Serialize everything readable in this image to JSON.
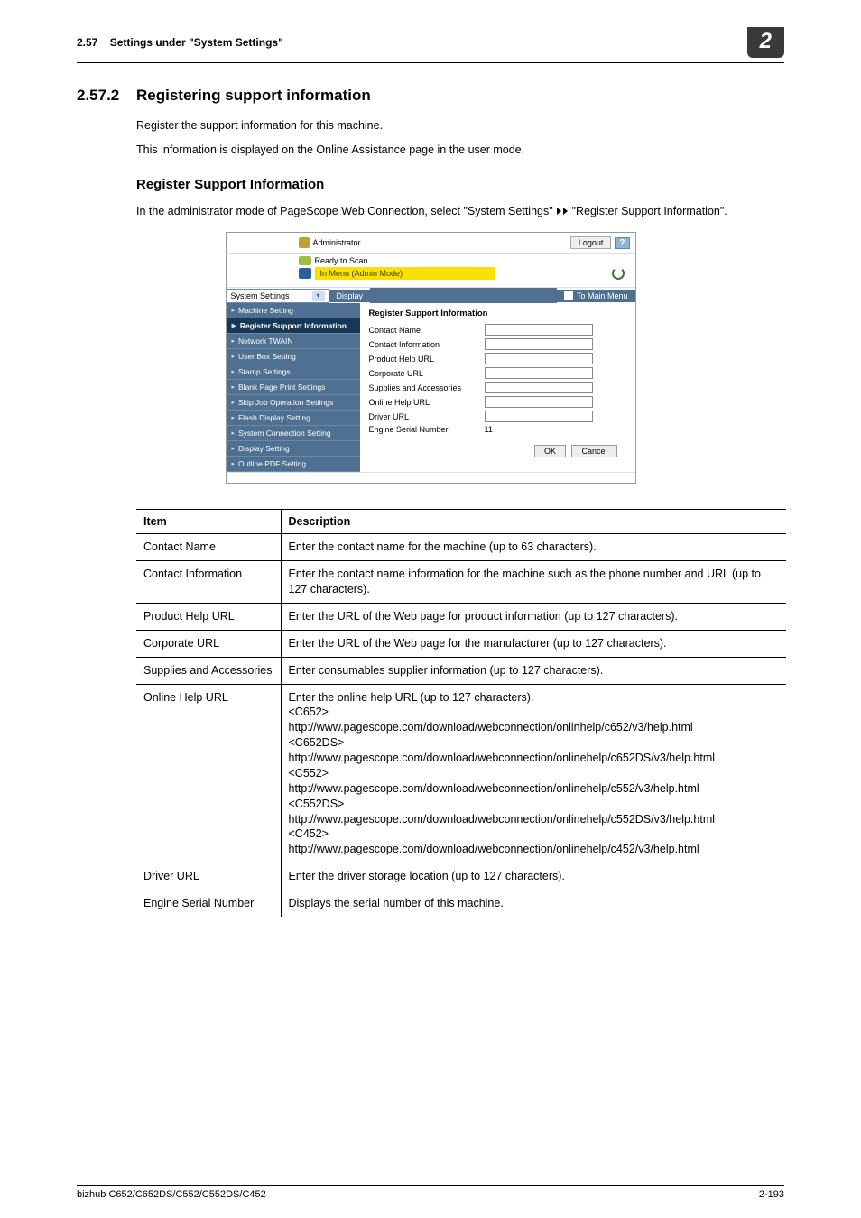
{
  "header": {
    "section_ref": "2.57",
    "section_label": "Settings under \"System Settings\"",
    "chapter_badge": "2"
  },
  "section": {
    "number": "2.57.2",
    "title": "Registering support information",
    "intro1": "Register the support information for this machine.",
    "intro2": "This information is displayed on the Online Assistance page in the user mode."
  },
  "subsection": {
    "title": "Register Support Information",
    "body_prefix": "In the administrator mode of PageScope Web Connection, select \"System Settings\" ",
    "body_suffix": " \"Register Support Information\"."
  },
  "screenshot": {
    "admin_label": "Administrator",
    "logout": "Logout",
    "help": "?",
    "ready": "Ready to Scan",
    "banner": "In Menu (Admin Mode)",
    "select_value": "System Settings",
    "display_btn": "Display",
    "to_main": "To Main Menu",
    "nav": [
      "Machine Setting",
      "Register Support Information",
      "Network TWAIN",
      "User Box Setting",
      "Stamp Settings",
      "Blank Page Print Settings",
      "Skip Job Operation Settings",
      "Flash Display Setting",
      "System Connection Setting",
      "Display Setting",
      "Outline PDF Setting"
    ],
    "form_title": "Register Support Information",
    "fields": [
      "Contact Name",
      "Contact Information",
      "Product Help URL",
      "Corporate URL",
      "Supplies and Accessories",
      "Online Help URL",
      "Driver URL"
    ],
    "serial_label": "Engine Serial Number",
    "serial_value": "11",
    "ok": "OK",
    "cancel": "Cancel"
  },
  "table": {
    "head_item": "Item",
    "head_desc": "Description",
    "rows": [
      {
        "item": "Contact Name",
        "desc": "Enter the contact name for the machine (up to 63 characters)."
      },
      {
        "item": "Contact Information",
        "desc": "Enter the contact name information for the machine such as the phone number and URL (up to 127 characters)."
      },
      {
        "item": "Product Help URL",
        "desc": "Enter the URL of the Web page for product information (up to 127 characters)."
      },
      {
        "item": "Corporate URL",
        "desc": "Enter the URL of the Web page for the manufacturer (up to 127 characters)."
      },
      {
        "item": "Supplies and Accessories",
        "desc": "Enter consumables supplier information (up to 127 characters)."
      },
      {
        "item": "Online Help URL",
        "desc": "Enter the online help URL (up to 127 characters).\n<C652>\nhttp://www.pagescope.com/download/webconnection/onlinhelp/c652/v3/help.html\n<C652DS>\nhttp://www.pagescope.com/download/webconnection/onlinehelp/c652DS/v3/help.html\n<C552>\nhttp://www.pagescope.com/download/webconnection/onlinehelp/c552/v3/help.html\n<C552DS>\nhttp://www.pagescope.com/download/webconnection/onlinehelp/c552DS/v3/help.html\n<C452>\nhttp://www.pagescope.com/download/webconnection/onlinehelp/c452/v3/help.html"
      },
      {
        "item": "Driver URL",
        "desc": "Enter the driver storage location (up to 127 characters)."
      },
      {
        "item": "Engine Serial Number",
        "desc": "Displays the serial number of this machine."
      }
    ]
  },
  "footer": {
    "left": "bizhub C652/C652DS/C552/C552DS/C452",
    "right": "2-193"
  }
}
